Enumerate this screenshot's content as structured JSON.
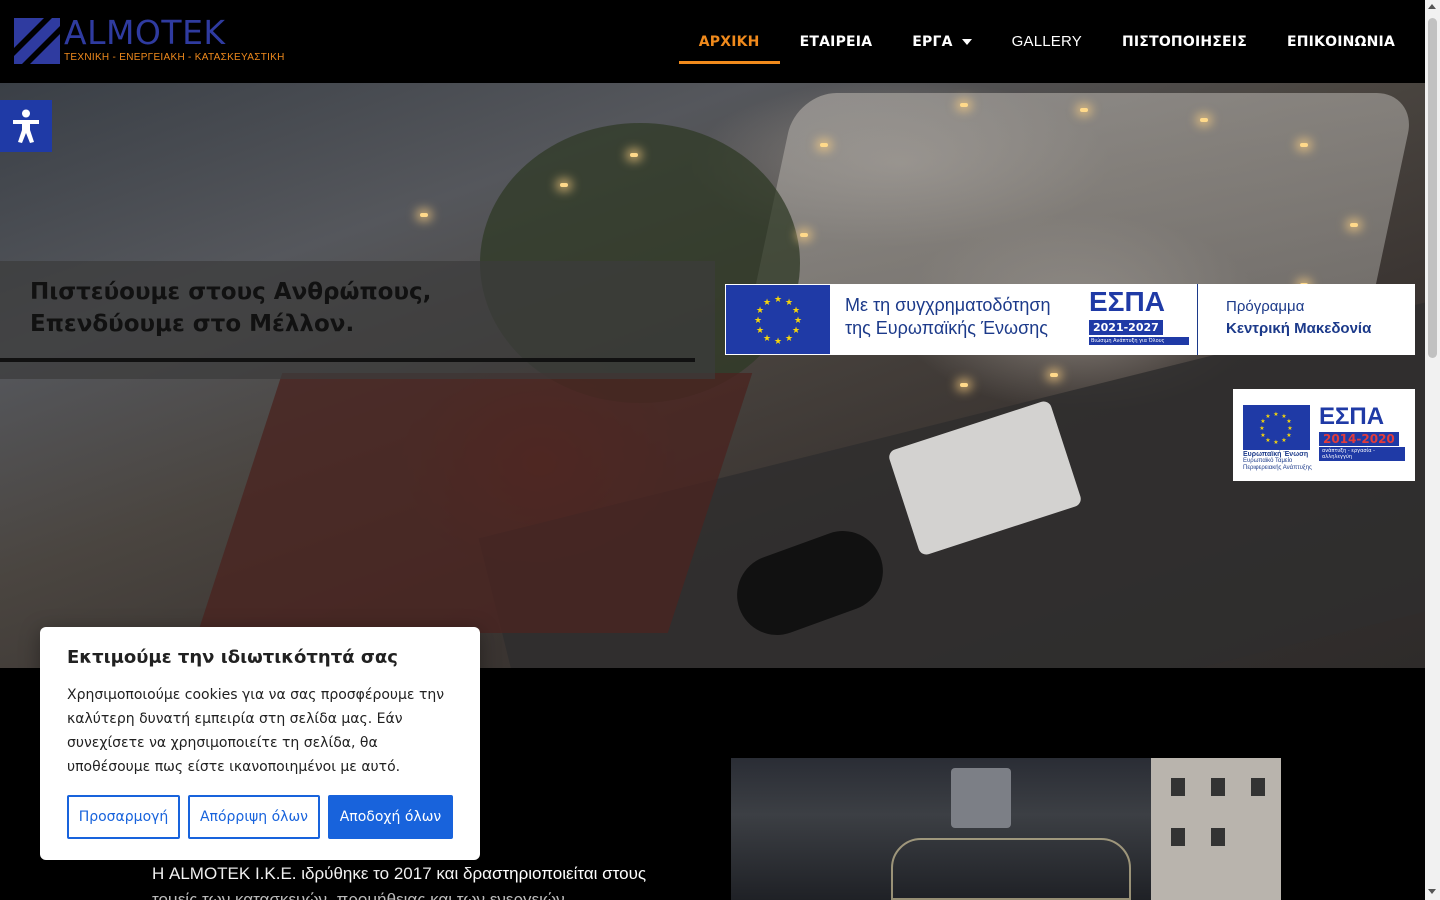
{
  "header": {
    "logo": {
      "name": "ALMOTEK",
      "tagline": "ΤΕΧΝΙΚΗ - ΕΝΕΡΓΕΙΑΚΗ - ΚΑΤΑΣΚΕΥΑΣΤΙΚΗ"
    },
    "nav": [
      {
        "label": "ΑΡΧΙΚΗ",
        "active": true
      },
      {
        "label": "ΕΤΑΙΡΕΙΑ",
        "active": false
      },
      {
        "label": "ΕΡΓΑ",
        "active": false,
        "has_dropdown": true
      },
      {
        "label": "GALLERY",
        "active": false
      },
      {
        "label": "ΠΙΣΤΟΠΟΙΗΣΕΙΣ",
        "active": false
      },
      {
        "label": "ΕΠΙΚΟΙΝΩΝΙΑ",
        "active": false
      }
    ]
  },
  "hero": {
    "tagline_line1": "Πιστεύουμε στους Ανθρώπους,",
    "tagline_line2": "Επενδύουμε στο Μέλλον."
  },
  "espa_banner": {
    "text_line1": "Με τη συγχρηματοδότηση",
    "text_line2": "της Ευρωπαϊκής Ένωσης",
    "espa": "ΕΣΠΑ",
    "years": "2021-2027",
    "subtitle": "Βιώσιμη Ανάπτυξη για Όλους",
    "program_label": "Πρόγραμμα",
    "program_name": "Κεντρική Μακεδονία"
  },
  "espa_small": {
    "eu_caption_1": "Ευρωπαϊκή Ένωση",
    "eu_caption_2": "Ευρωπαϊκό Ταμείο",
    "eu_caption_3": "Περιφερειακής Ανάπτυξης",
    "espa": "ΕΣΠΑ",
    "years": "2014-2020",
    "subtitle": "ανάπτυξη - εργασία - αλληλεγγύη"
  },
  "about": {
    "line1": "Η ALMOTEK Ι.Κ.Ε. ιδρύθηκε το 2017 και δραστηριοποιείται στους",
    "line2": "τομείς των κατασκευών, προμήθειας και των ενεργειών"
  },
  "cookie": {
    "title": "Εκτιμούμε την ιδιωτικότητά σας",
    "body": "Χρησιμοποιούμε cookies για να σας προσφέρουμε την καλύτερη δυνατή εμπειρία στη σελίδα μας. Εάν συνεχίσετε να χρησιμοποιείτε τη σελίδα, θα υποθέσουμε πως είστε ικανοποιημένοι με αυτό.",
    "customize": "Προσαρμογή",
    "reject": "Απόρριψη όλων",
    "accept": "Αποδοχή όλων"
  },
  "colors": {
    "accent": "#f08a1c",
    "brand_blue": "#2f3ba0",
    "cookie_blue": "#1863dc"
  },
  "icons": {
    "accessibility": "accessibility-icon",
    "dropdown": "chevron-down-icon"
  }
}
